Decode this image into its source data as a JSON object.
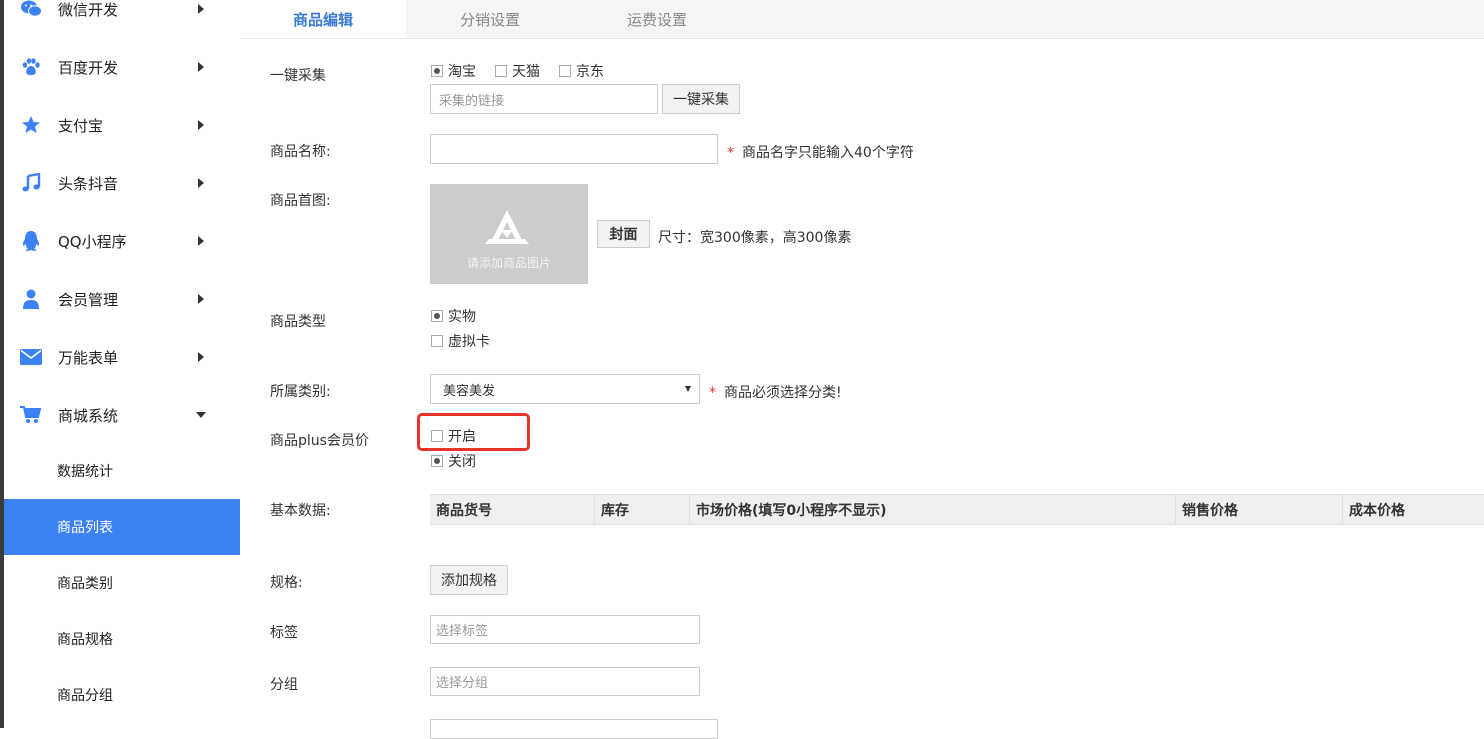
{
  "sidebar": {
    "items": [
      {
        "label": "微信开发",
        "icon": "wechat-icon"
      },
      {
        "label": "百度开发",
        "icon": "paw-icon"
      },
      {
        "label": "支付宝",
        "icon": "star-icon"
      },
      {
        "label": "头条抖音",
        "icon": "music-note-icon"
      },
      {
        "label": "QQ小程序",
        "icon": "qq-penguin-icon"
      },
      {
        "label": "会员管理",
        "icon": "user-icon"
      },
      {
        "label": "万能表单",
        "icon": "envelope-icon"
      },
      {
        "label": "商城系统",
        "icon": "cart-icon"
      }
    ],
    "subitems": [
      {
        "label": "数据统计"
      },
      {
        "label": "商品列表"
      },
      {
        "label": "商品类别"
      },
      {
        "label": "商品规格"
      },
      {
        "label": "商品分组"
      }
    ],
    "active_sub": "商品列表",
    "accent": "#3d82f4"
  },
  "tabs": [
    {
      "label": "商品编辑"
    },
    {
      "label": "分销设置"
    },
    {
      "label": "运费设置"
    }
  ],
  "form": {
    "collect": {
      "label": "一键采集",
      "options": [
        "淘宝",
        "天猫",
        "京东"
      ],
      "selected": "淘宝",
      "link_placeholder": "采集的链接",
      "button": "一键采集"
    },
    "name": {
      "label": "商品名称:",
      "value": "",
      "hint": "商品名字只能输入40个字符"
    },
    "cover": {
      "label": "商品首图:",
      "placeholder": "请添加商品图片",
      "button": "封面",
      "hint": "尺寸：宽300像素，高300像素"
    },
    "type": {
      "label": "商品类型",
      "options": [
        "实物",
        "虚拟卡"
      ],
      "selected": "实物"
    },
    "category": {
      "label": "所属类别:",
      "value": "美容美发",
      "hint": "商品必须选择分类!"
    },
    "plus": {
      "label": "商品plus会员价",
      "options": [
        "开启",
        "关闭"
      ],
      "selected": "关闭"
    },
    "basic": {
      "label": "基本数据:",
      "columns": [
        "商品货号",
        "库存",
        "市场价格(填写0小程序不显示)",
        "销售价格",
        "成本价格"
      ]
    },
    "spec": {
      "label": "规格:",
      "button": "添加规格"
    },
    "tag": {
      "label": "标签",
      "placeholder": "选择标签"
    },
    "group": {
      "label": "分组",
      "placeholder": "选择分组"
    }
  },
  "colors": {
    "highlight_border": "#e5352b",
    "required_star": "#e5352b",
    "tab_active": "#3b7bd4"
  }
}
